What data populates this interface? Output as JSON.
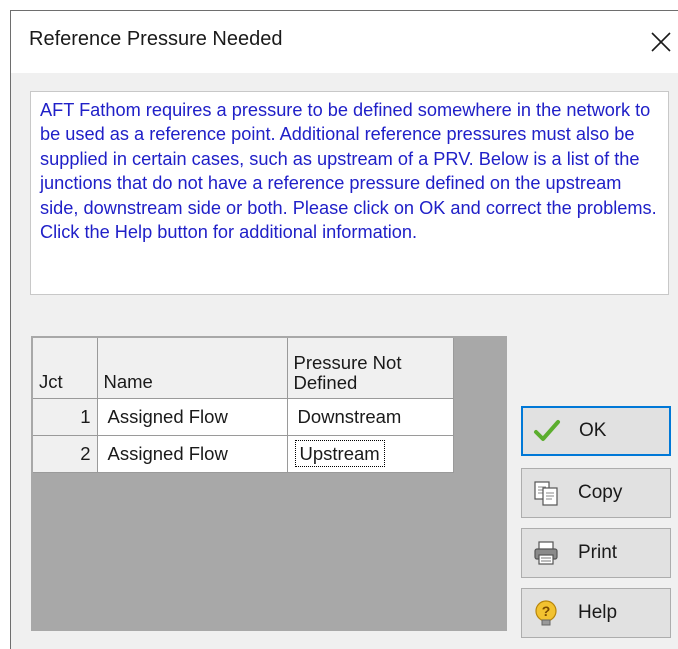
{
  "dialog": {
    "title": "Reference Pressure Needed",
    "message": "AFT Fathom requires a pressure to be defined somewhere in the network to be used as a reference point.  Additional reference pressures must also be supplied in certain cases, such as upstream of a PRV.  Below is a list of the junctions that do not have a reference pressure defined on the upstream side, downstream side or both.  Please click on OK and correct the problems.  Click the Help button for additional information."
  },
  "table": {
    "headers": {
      "jct": "Jct",
      "name": "Name",
      "pressure_not_defined_line1": "Pressure Not",
      "pressure_not_defined_line2": "Defined"
    },
    "rows": [
      {
        "jct": "1",
        "name": "Assigned Flow",
        "pressure_not_defined": "Downstream"
      },
      {
        "jct": "2",
        "name": "Assigned Flow",
        "pressure_not_defined": "Upstream"
      }
    ]
  },
  "buttons": {
    "ok": "OK",
    "copy": "Copy",
    "print": "Print",
    "help": "Help"
  },
  "icons": {
    "close": "close-icon",
    "ok": "checkmark-icon",
    "copy": "copy-icon",
    "print": "printer-icon",
    "help": "help-icon"
  },
  "colors": {
    "message_text": "#2020c8",
    "default_button_border": "#0078d7",
    "checkmark": "#5cae2e",
    "help_bulb": "#f2c230"
  }
}
